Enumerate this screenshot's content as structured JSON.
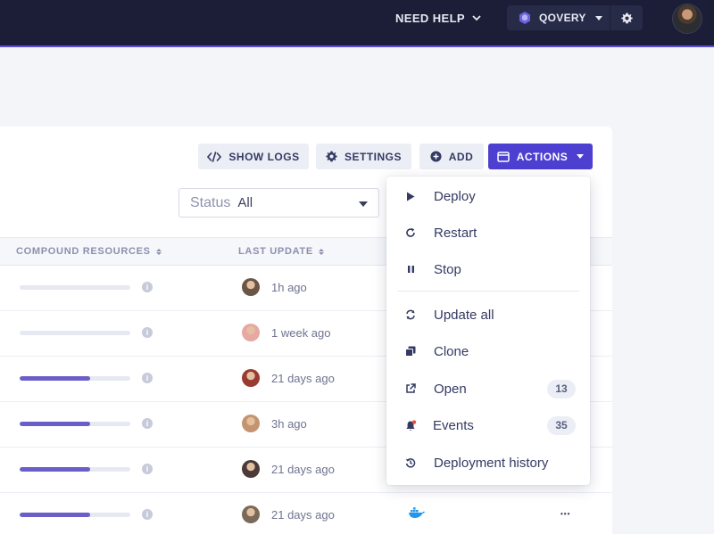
{
  "topbar": {
    "need_help": "NEED HELP",
    "org_name": "QOVERY"
  },
  "toolbar": {
    "show_logs": "SHOW LOGS",
    "settings": "SETTINGS",
    "add": "ADD",
    "actions": "ACTIONS"
  },
  "filter": {
    "label": "Status",
    "value": "All"
  },
  "table": {
    "columns": {
      "compound_resources": "COMPOUND RESOURCES",
      "last_update": "LAST UPDATE"
    },
    "rows": [
      {
        "resource_fill": 0,
        "last_update": "1h ago",
        "avatar_color": "#6b5546"
      },
      {
        "resource_fill": 0,
        "last_update": "1 week ago",
        "avatar_color": "#e7a7a3"
      },
      {
        "resource_fill": 0.64,
        "last_update": "21 days ago",
        "avatar_color": "#9a3b32"
      },
      {
        "resource_fill": 0.64,
        "last_update": "3h ago",
        "avatar_color": "#c49470"
      },
      {
        "resource_fill": 0.64,
        "last_update": "21 days ago",
        "avatar_color": "#4a3a3a"
      },
      {
        "resource_fill": 0.64,
        "last_update": "21 days ago",
        "avatar_color": "#7a6a5a"
      }
    ]
  },
  "actions_menu": {
    "items": [
      {
        "label": "Deploy",
        "icon": "play-icon"
      },
      {
        "label": "Restart",
        "icon": "restart-icon"
      },
      {
        "label": "Stop",
        "icon": "pause-icon"
      },
      {
        "label": "Update all",
        "icon": "sync-icon"
      },
      {
        "label": "Clone",
        "icon": "clone-icon"
      },
      {
        "label": "Open",
        "icon": "external-link-icon",
        "badge": "13"
      },
      {
        "label": "Events",
        "icon": "bell-icon",
        "badge": "35"
      },
      {
        "label": "Deployment history",
        "icon": "history-icon"
      }
    ]
  },
  "colors": {
    "topbar_bg": "#1b1e36",
    "accent": "#4d3fd0",
    "progress": "#6a5ec9",
    "docker": "#2396ed"
  }
}
